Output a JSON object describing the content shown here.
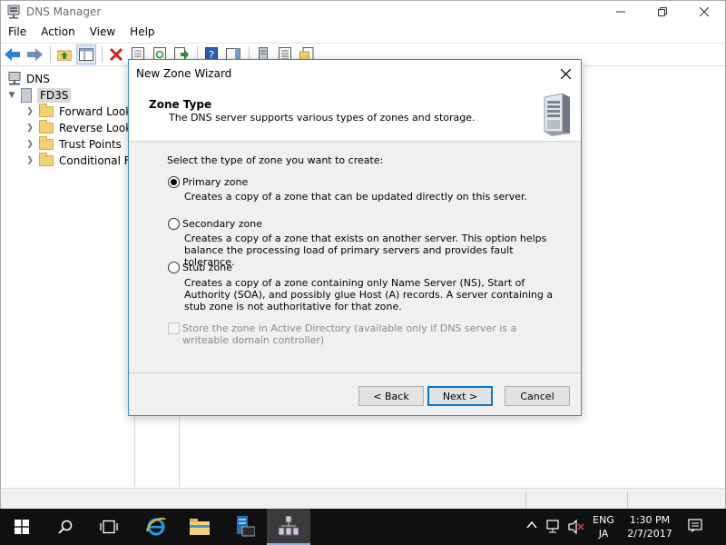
{
  "app": {
    "title": "DNS Manager"
  },
  "menu": [
    "File",
    "Action",
    "View",
    "Help"
  ],
  "tree": {
    "root": "DNS",
    "server": "FD3S",
    "children": [
      "Forward Looku",
      "Reverse Looku",
      "Trust Points",
      "Conditional Fo"
    ]
  },
  "wizard": {
    "title": "New Zone Wizard",
    "heading": "Zone Type",
    "subheading": "The DNS server supports various types of zones and storage.",
    "prompt": "Select the type of zone you want to create:",
    "options": [
      {
        "label": "Primary zone",
        "description": "Creates a copy of a zone that can be updated directly on this server.",
        "checked": true
      },
      {
        "label": "Secondary zone",
        "description": "Creates a copy of a zone that exists on another server. This option helps balance the processing load of primary servers and provides fault tolerance.",
        "checked": false
      },
      {
        "label": "Stub zone",
        "description": "Creates a copy of a zone containing only Name Server (NS), Start of Authority (SOA), and possibly glue Host (A) records. A server containing a stub zone is not authoritative for that zone.",
        "checked": false
      }
    ],
    "ad_checkbox": {
      "label": "Store the zone in Active Directory (available only if DNS server is a writeable domain controller)",
      "checked": false,
      "disabled": true
    },
    "buttons": {
      "back": "< Back",
      "next": "Next >",
      "cancel": "Cancel"
    }
  },
  "taskbar": {
    "lang_top": "ENG",
    "lang_bottom": "JA",
    "time": "1:30 PM",
    "date": "2/7/2017"
  },
  "colors": {
    "accent": "#0078d7",
    "taskbar": "#101010",
    "dialog_border": "#3c8bd3",
    "folder": "#f4d274"
  }
}
